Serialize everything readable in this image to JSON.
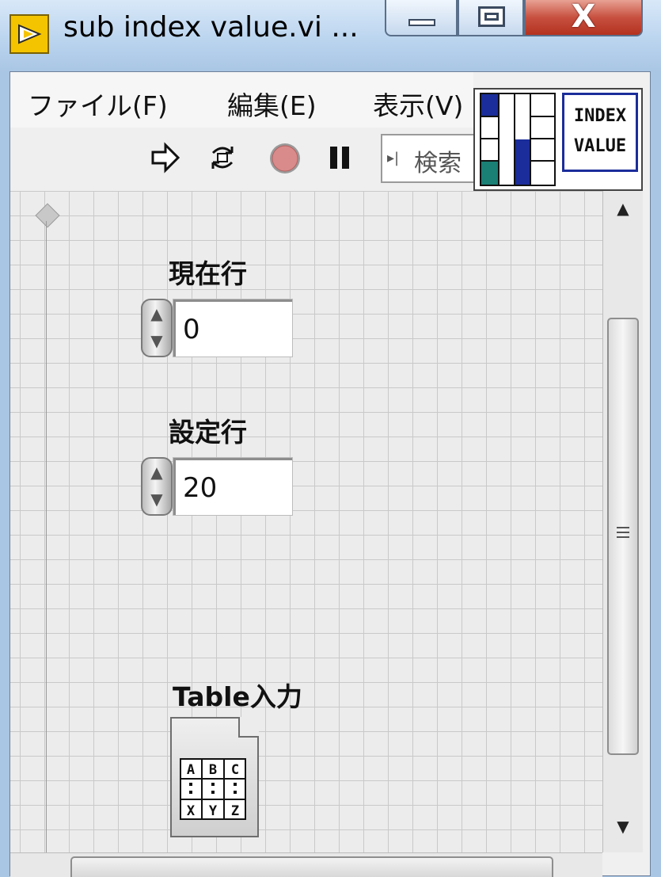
{
  "window": {
    "title": "sub index value.vi ...",
    "close_label": "X"
  },
  "menu": {
    "items": [
      "ファイル(F)",
      "編集(E)",
      "表示(V)"
    ]
  },
  "toolbar": {
    "search_placeholder": "検索"
  },
  "icon_text": {
    "line1": "INDEX",
    "line2": "VALUE"
  },
  "controls": {
    "current_row": {
      "label": "現在行",
      "value": "0"
    },
    "set_row": {
      "label": "設定行",
      "value": "20"
    },
    "table_input": {
      "label": "Table入力"
    }
  },
  "table_icon_cells": [
    "A",
    "B",
    "C",
    "X",
    "Y",
    "Z"
  ],
  "colors": {
    "title_bg": "#b9d3ee",
    "close_red": "#c75040",
    "run_stop_red": "#d98a8a",
    "connector_blue": "#1b2d9a",
    "connector_teal": "#1a7f75"
  }
}
